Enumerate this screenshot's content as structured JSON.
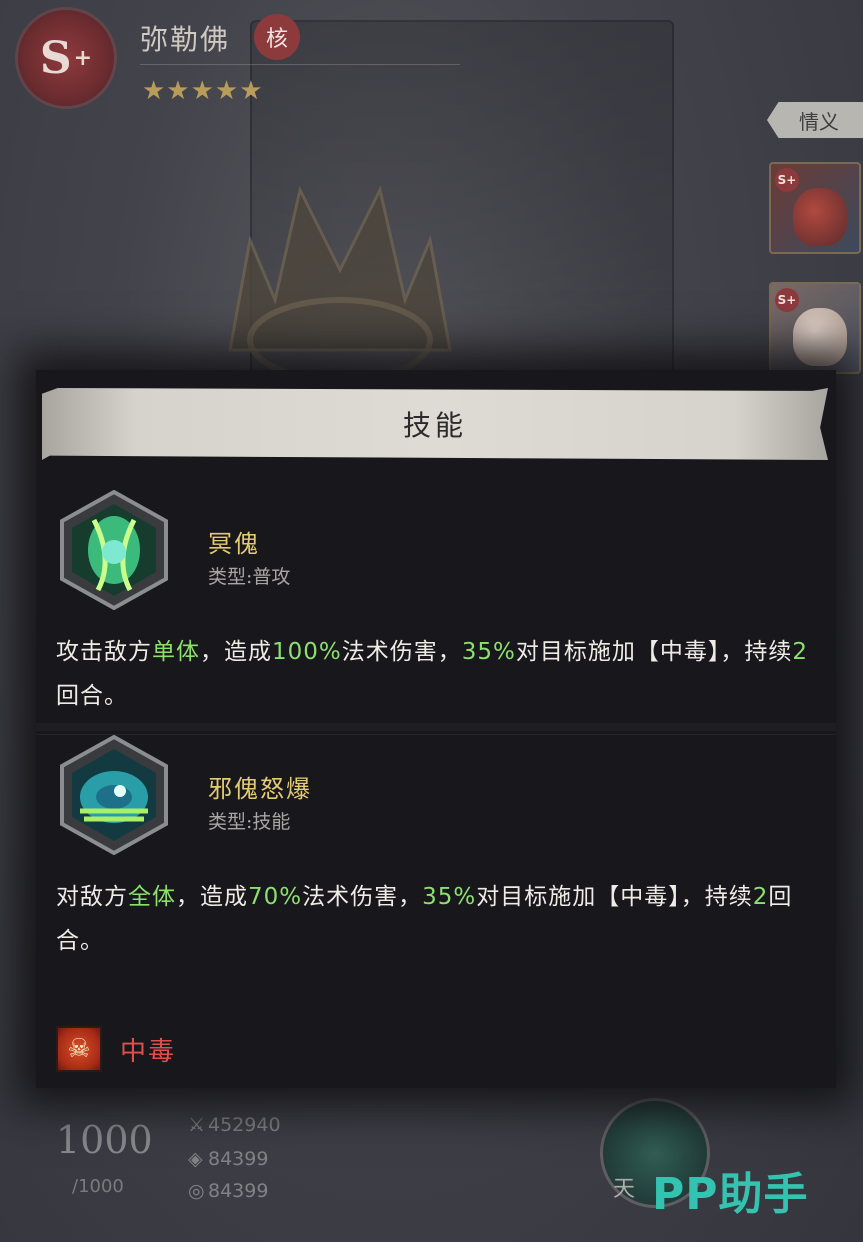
{
  "hero": {
    "rank": "S",
    "rank_plus": "+",
    "name": "弥勒佛",
    "core_seal": "核",
    "stars": "★★★★★",
    "star_count": 5,
    "faction_tag": "情义"
  },
  "side_portraits": [
    {
      "rank": "S+",
      "icon": "red-demon-portrait"
    },
    {
      "rank": "S+",
      "icon": "child-monk-portrait"
    }
  ],
  "panel": {
    "title": "技能",
    "skills": [
      {
        "name": "冥傀",
        "type": "类型:普攻",
        "icon": "green-spirit-mask-icon",
        "desc": [
          {
            "t": "攻击敌方",
            "hl": false
          },
          {
            "t": "单体",
            "hl": true
          },
          {
            "t": "，造成",
            "hl": false
          },
          {
            "t": "100%",
            "hl": true
          },
          {
            "t": "法术伤害，",
            "hl": false
          },
          {
            "t": "35%",
            "hl": true
          },
          {
            "t": "对目标施加【中毒】，持续",
            "hl": false
          },
          {
            "t": "2",
            "hl": true
          },
          {
            "t": "回合。",
            "hl": false
          }
        ]
      },
      {
        "name": "邪傀怒爆",
        "type": "类型:技能",
        "icon": "cyan-spirit-burst-icon",
        "desc": [
          {
            "t": "对敌方",
            "hl": false
          },
          {
            "t": "全体",
            "hl": true
          },
          {
            "t": "，造成",
            "hl": false
          },
          {
            "t": "70%",
            "hl": true
          },
          {
            "t": "法术伤害，",
            "hl": false
          },
          {
            "t": "35%",
            "hl": true
          },
          {
            "t": "对目标施加【中毒】，持续",
            "hl": false
          },
          {
            "t": "2",
            "hl": true
          },
          {
            "t": "回合。",
            "hl": false
          }
        ]
      }
    ],
    "status_effect": {
      "label": "中毒",
      "icon": "skull-poison-icon"
    }
  },
  "bottom_stats": {
    "power": "1000",
    "power_max": "/1000",
    "stat1": "452940",
    "stat2": "84399",
    "stat3": "84399",
    "bagua_label": "天"
  },
  "watermark": "PP助手",
  "colors": {
    "highlight": "#8ddf6e",
    "skill_name": "#e4cc72",
    "poison": "#e0504a",
    "panel_bg": "#17171c"
  }
}
